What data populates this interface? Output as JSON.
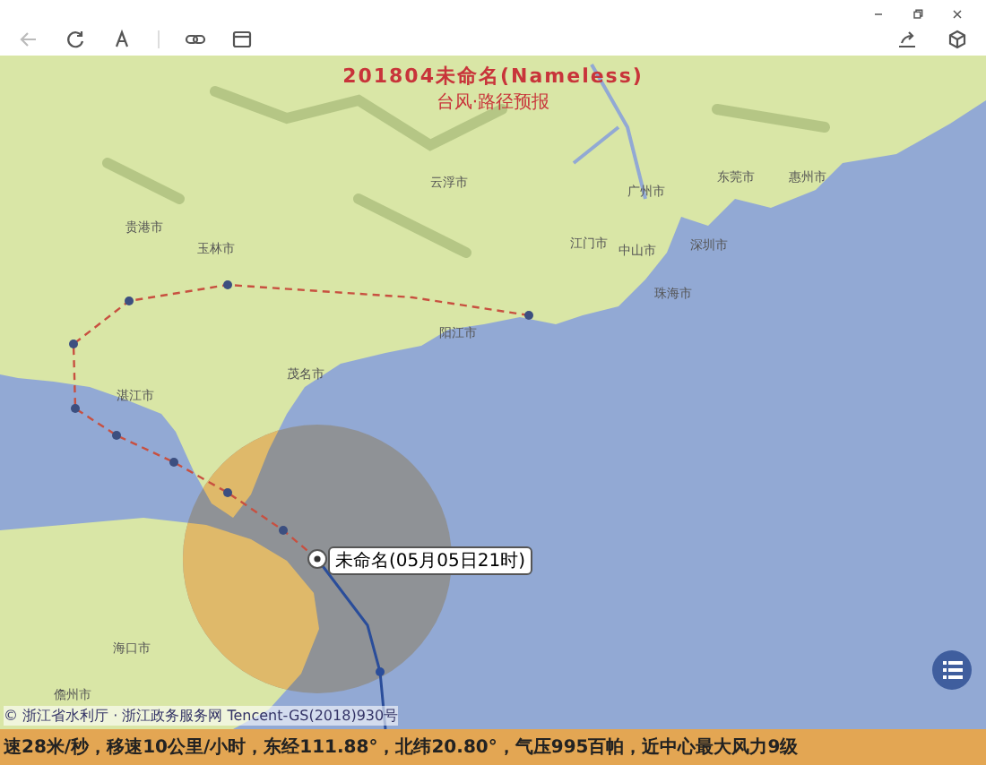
{
  "map": {
    "title": "201804未命名(Nameless)",
    "subtitle": "台风·路径预报",
    "cities": [
      {
        "name": "贵港市"
      },
      {
        "name": "玉林市"
      },
      {
        "name": "云浮市"
      },
      {
        "name": "广州市"
      },
      {
        "name": "东莞市"
      },
      {
        "name": "惠州市"
      },
      {
        "name": "江门市"
      },
      {
        "name": "中山市"
      },
      {
        "name": "深圳市"
      },
      {
        "name": "珠海市"
      },
      {
        "name": "阳江市"
      },
      {
        "name": "茂名市"
      },
      {
        "name": "湛江市"
      },
      {
        "name": "海口市"
      },
      {
        "name": "儋州市"
      }
    ],
    "storm_label": "未命名(05月05日21时)",
    "attribution": "© 浙江省水利厅 · 浙江政务服务网 Tencent-GS(2018)930号"
  },
  "status_bar": {
    "text": "速28米/秒，移速10公里/小时，东经111.88°，北纬20.80°，气压995百帕，近中心最大风力9级"
  }
}
